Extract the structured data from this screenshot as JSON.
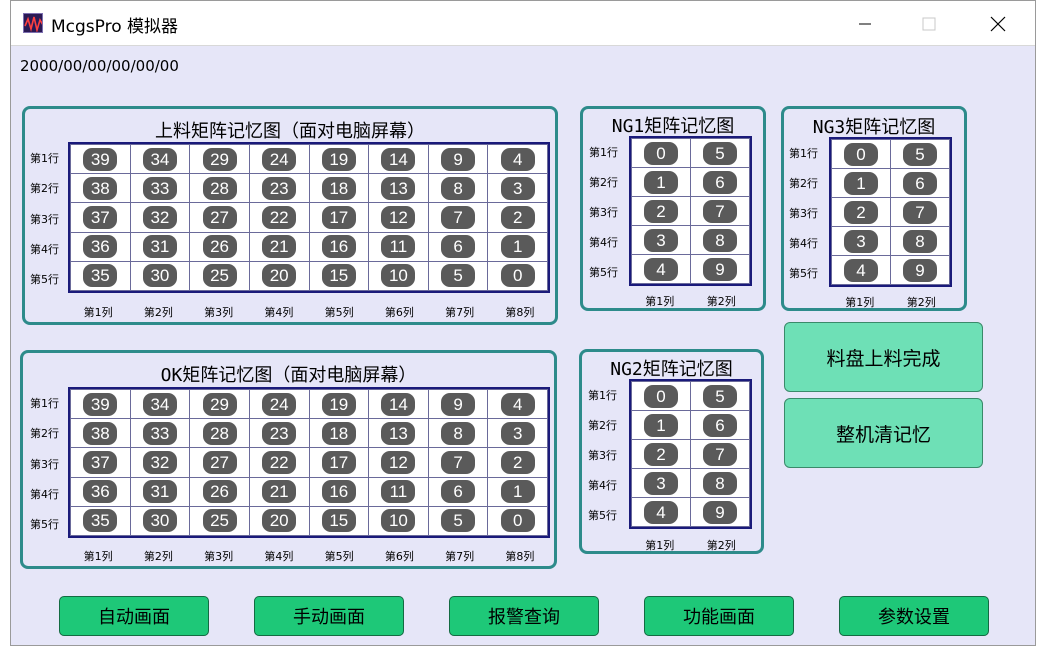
{
  "window": {
    "title": "McgsPro 模拟器"
  },
  "datetime": "2000/00/00/00/00/00",
  "rows": [
    "第1行",
    "第2行",
    "第3行",
    "第4行",
    "第5行"
  ],
  "cols8": [
    "第1列",
    "第2列",
    "第3列",
    "第4列",
    "第5列",
    "第6列",
    "第7列",
    "第8列"
  ],
  "cols2": [
    "第1列",
    "第2列"
  ],
  "panels": {
    "load": {
      "title": "上料矩阵记忆图（面对电脑屏幕）",
      "cells": [
        [
          "39",
          "34",
          "29",
          "24",
          "19",
          "14",
          "9",
          "4"
        ],
        [
          "38",
          "33",
          "28",
          "23",
          "18",
          "13",
          "8",
          "3"
        ],
        [
          "37",
          "32",
          "27",
          "22",
          "17",
          "12",
          "7",
          "2"
        ],
        [
          "36",
          "31",
          "26",
          "21",
          "16",
          "11",
          "6",
          "1"
        ],
        [
          "35",
          "30",
          "25",
          "20",
          "15",
          "10",
          "5",
          "0"
        ]
      ]
    },
    "ok": {
      "title": "OK矩阵记忆图（面对电脑屏幕）",
      "cells": [
        [
          "39",
          "34",
          "29",
          "24",
          "19",
          "14",
          "9",
          "4"
        ],
        [
          "38",
          "33",
          "28",
          "23",
          "18",
          "13",
          "8",
          "3"
        ],
        [
          "37",
          "32",
          "27",
          "22",
          "17",
          "12",
          "7",
          "2"
        ],
        [
          "36",
          "31",
          "26",
          "21",
          "16",
          "11",
          "6",
          "1"
        ],
        [
          "35",
          "30",
          "25",
          "20",
          "15",
          "10",
          "5",
          "0"
        ]
      ]
    },
    "ng1": {
      "title": "NG1矩阵记忆图",
      "cells": [
        [
          "0",
          "5"
        ],
        [
          "1",
          "6"
        ],
        [
          "2",
          "7"
        ],
        [
          "3",
          "8"
        ],
        [
          "4",
          "9"
        ]
      ]
    },
    "ng3": {
      "title": "NG3矩阵记忆图",
      "cells": [
        [
          "0",
          "5"
        ],
        [
          "1",
          "6"
        ],
        [
          "2",
          "7"
        ],
        [
          "3",
          "8"
        ],
        [
          "4",
          "9"
        ]
      ]
    },
    "ng2": {
      "title": "NG2矩阵记忆图",
      "cells": [
        [
          "0",
          "5"
        ],
        [
          "1",
          "6"
        ],
        [
          "2",
          "7"
        ],
        [
          "3",
          "8"
        ],
        [
          "4",
          "9"
        ]
      ]
    }
  },
  "actions": {
    "tray_loaded": "料盘上料完成",
    "clear_memory": "整机清记忆"
  },
  "nav": [
    "自动画面",
    "手动画面",
    "报警查询",
    "功能画面",
    "参数设置"
  ],
  "colors": {
    "panel_border": "#2d8b8b",
    "chip": "#5a5a5a",
    "action_button": "#6ee0b6",
    "nav_button": "#1ec878",
    "background": "#e6e6f8"
  }
}
